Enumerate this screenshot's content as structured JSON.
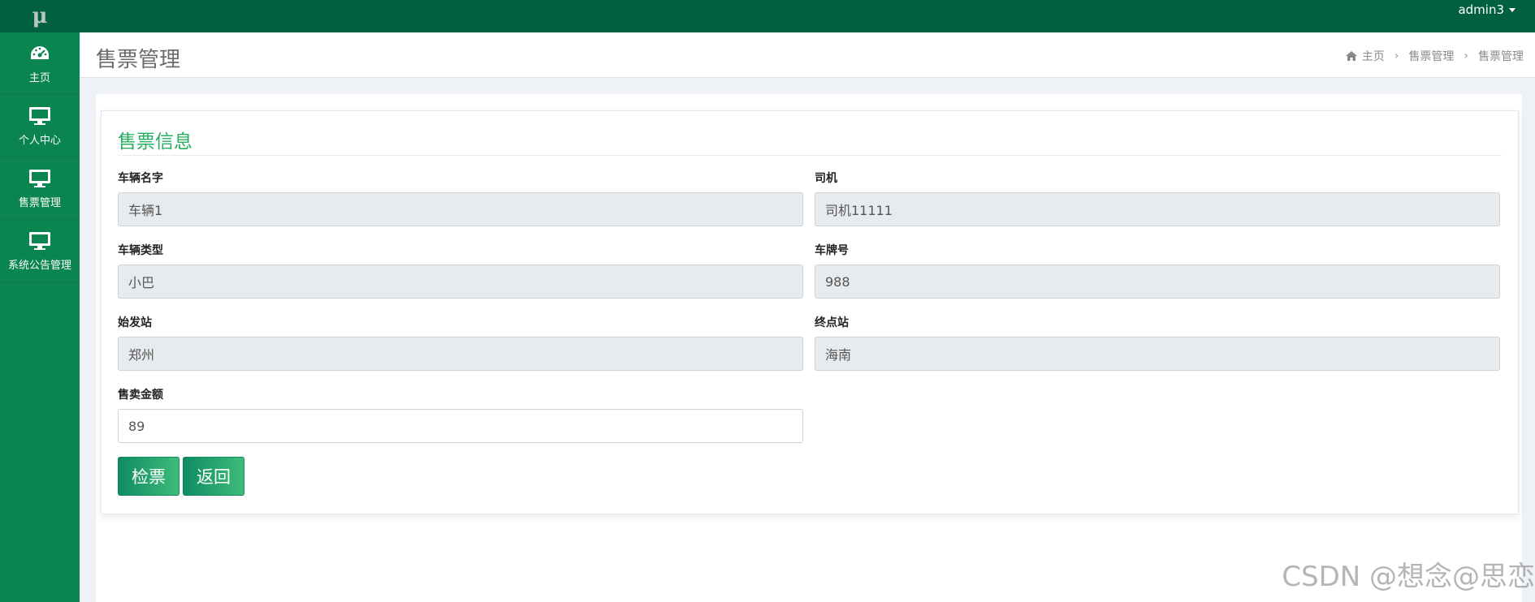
{
  "logo": {
    "text": "μ"
  },
  "topbar": {
    "user": "admin3"
  },
  "sidebar": {
    "items": [
      {
        "label": "主页",
        "icon": "dashboard-icon"
      },
      {
        "label": "个人中心",
        "icon": "monitor-icon"
      },
      {
        "label": "售票管理",
        "icon": "monitor-icon"
      },
      {
        "label": "系统公告管理",
        "icon": "monitor-icon"
      }
    ]
  },
  "header": {
    "title": "售票管理",
    "breadcrumb": [
      "主页",
      "售票管理",
      "售票管理"
    ]
  },
  "panel": {
    "title": "售票信息",
    "fields": {
      "vehicle_name": {
        "label": "车辆名字",
        "value": "车辆1"
      },
      "driver": {
        "label": "司机",
        "value": "司机11111"
      },
      "vehicle_type": {
        "label": "车辆类型",
        "value": "小巴"
      },
      "plate": {
        "label": "车牌号",
        "value": "988"
      },
      "origin": {
        "label": "始发站",
        "value": "郑州"
      },
      "destination": {
        "label": "终点站",
        "value": "海南"
      },
      "amount": {
        "label": "售卖金额",
        "value": "89"
      }
    },
    "buttons": {
      "check": "检票",
      "back": "返回"
    }
  },
  "watermark": "CSDN @想念@思恋",
  "colors": {
    "sidebar": "#0a8550",
    "topbar": "#006041",
    "accent": "#27ae60"
  }
}
